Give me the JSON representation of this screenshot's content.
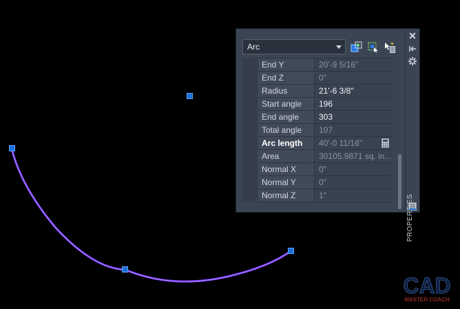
{
  "colors": {
    "arc": "#7c3cff",
    "grip": "#1e6fd6",
    "panel": "#3b4453"
  },
  "drawing": {
    "arc_type_label": "Arc"
  },
  "palette": {
    "title": "PROPERTIES",
    "object_type": "Arc",
    "rows": [
      {
        "label": "End Y",
        "value": "20'-9 5/16\"",
        "editable": false
      },
      {
        "label": "End Z",
        "value": "0\"",
        "editable": false
      },
      {
        "label": "Radius",
        "value": "21'-6 3/8\"",
        "editable": true
      },
      {
        "label": "Start angle",
        "value": "196",
        "editable": true
      },
      {
        "label": "End angle",
        "value": "303",
        "editable": true
      },
      {
        "label": "Total angle",
        "value": "107",
        "editable": false
      },
      {
        "label": "Arc length",
        "value": "40'-0 11/16\"",
        "editable": false
      },
      {
        "label": "Area",
        "value": "30105.9871 sq. in....",
        "editable": false
      },
      {
        "label": "Normal X",
        "value": "0\"",
        "editable": false
      },
      {
        "label": "Normal Y",
        "value": "0\"",
        "editable": false
      },
      {
        "label": "Normal Z",
        "value": "1\"",
        "editable": false
      }
    ],
    "icons": [
      "close-icon",
      "auto-hide-icon",
      "settings-icon",
      "properties-icon",
      "quick-select-icon",
      "select-objects-icon",
      "toggle-pickadd-icon",
      "calculator-icon"
    ]
  },
  "watermark": {
    "line1": "CAD",
    "line2": "MASTER COACH"
  }
}
